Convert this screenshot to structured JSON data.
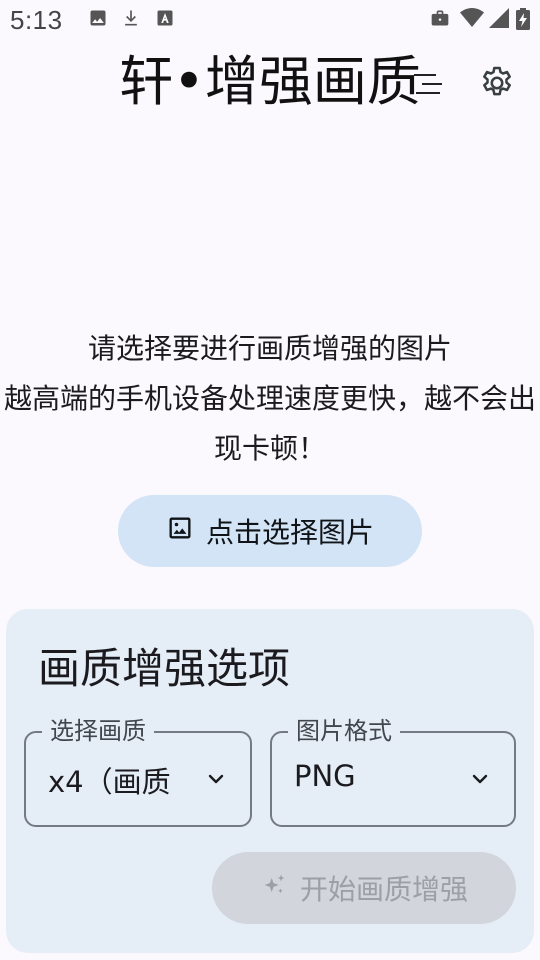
{
  "status_bar": {
    "time": "5:13",
    "icons": [
      "image-icon",
      "download-icon",
      "font-a-icon",
      "briefcase-icon",
      "wifi-icon",
      "signal-icon",
      "battery-icon"
    ]
  },
  "header": {
    "title": "轩•增强画质",
    "settings_icon": "gear-icon"
  },
  "prompt": {
    "line1": "请选择要进行画质增强的图片",
    "line2": "越高端的手机设备处理速度更快，越不会出现卡顿！"
  },
  "pick_button": {
    "label": "点击选择图片",
    "icon": "image-icon"
  },
  "options": {
    "title": "画质增强选项",
    "quality": {
      "label": "选择画质",
      "value": "x4（画质"
    },
    "format": {
      "label": "图片格式",
      "value": "PNG"
    },
    "start_button": {
      "label": "开始画质增强",
      "icon": "sparkle-icon",
      "enabled": false
    }
  },
  "colors": {
    "background": "#fbf9fe",
    "pick_button": "#d3e4f6",
    "options_card": "#e5edf6",
    "start_button_disabled": "#d2d6dc"
  }
}
